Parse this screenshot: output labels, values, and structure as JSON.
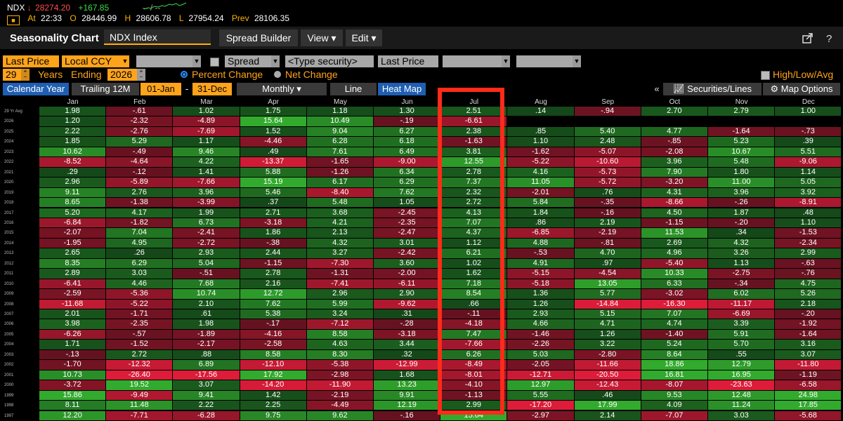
{
  "ticker": {
    "symbol": "NDX",
    "direction_glyph": "↓",
    "last": "28274.20",
    "change": "+167.85",
    "dash": "-- / --",
    "at_label": "At",
    "time": "22:33",
    "open_label": "O",
    "open": "28446.99",
    "high_label": "H",
    "high": "28606.78",
    "low_label": "L",
    "low": "27954.24",
    "prev_label": "Prev",
    "prev": "28106.35"
  },
  "header": {
    "title": "Seasonality Chart",
    "security": "NDX Index",
    "spread_builder": "Spread Builder",
    "view": "View ▾",
    "edit": "Edit ▾"
  },
  "options": {
    "price_field": "Last Price",
    "currency": "Local CCY",
    "spread": "Spread",
    "type_security": "<Type security>",
    "price_field2": "Last Price",
    "years": "29",
    "years_label": "Years",
    "ending_label": "Ending",
    "ending_year": "2026",
    "percent_change": "Percent Change",
    "net_change": "Net Change",
    "high_low_avg": "High/Low/Avg",
    "calendar_year": "Calendar Year",
    "trailing": "Trailing 12M",
    "start_date": "01-Jan",
    "range_dash": "-",
    "end_date": "31-Dec",
    "period": "Monthly ▾",
    "line": "Line",
    "heat_map": "Heat Map",
    "collapse": "«",
    "securities_lines": "Securities/Lines",
    "map_options": "Map Options"
  },
  "colors": {
    "accent": "#ffa31a",
    "highlight": "#ff2a1a",
    "active_tab": "#1f5fb3"
  },
  "heatmap": {
    "months": [
      "Jan",
      "Feb",
      "Mar",
      "Apr",
      "May",
      "Jun",
      "Jul",
      "Aug",
      "Sep",
      "Oct",
      "Nov",
      "Dec"
    ],
    "rows": [
      {
        "label": "29 Yr Avg",
        "values": [
          "1.98",
          "-.61",
          "1.02",
          "1.75",
          "1.18",
          "1.30",
          "2.51",
          ".14",
          "-.94",
          "2.70",
          "2.79",
          "1.00"
        ]
      },
      {
        "label": "2026",
        "values": [
          "1.20",
          "-2.32",
          "-4.89",
          "15.64",
          "10.49",
          "-.19",
          "-6.61",
          "",
          "",
          "",
          "",
          ""
        ]
      },
      {
        "label": "2025",
        "values": [
          "2.22",
          "-2.76",
          "-7.69",
          "1.52",
          "9.04",
          "6.27",
          "2.38",
          ".85",
          "5.40",
          "4.77",
          "-1.64",
          "-.73"
        ]
      },
      {
        "label": "2024",
        "values": [
          "1.85",
          "5.29",
          "1.17",
          "-4.46",
          "6.28",
          "6.18",
          "-1.63",
          "1.10",
          "2.48",
          "-.85",
          "5.23",
          ".39"
        ]
      },
      {
        "label": "2023",
        "values": [
          "10.62",
          "-.49",
          "9.46",
          ".49",
          "7.61",
          "6.49",
          "3.81",
          "-1.62",
          "-5.07",
          "-2.08",
          "10.67",
          "5.51"
        ]
      },
      {
        "label": "2022",
        "values": [
          "-8.52",
          "-4.64",
          "4.22",
          "-13.37",
          "-1.65",
          "-9.00",
          "12.55",
          "-5.22",
          "-10.60",
          "3.96",
          "5.48",
          "-9.06"
        ]
      },
      {
        "label": "2021",
        "values": [
          ".29",
          "-.12",
          "1.41",
          "5.88",
          "-1.26",
          "6.34",
          "2.78",
          "4.16",
          "-5.73",
          "7.90",
          "1.80",
          "1.14"
        ]
      },
      {
        "label": "2020",
        "values": [
          "2.96",
          "-5.89",
          "-7.66",
          "15.19",
          "6.17",
          "6.29",
          "7.37",
          "11.05",
          "-5.72",
          "-3.20",
          "11.00",
          "5.05"
        ]
      },
      {
        "label": "2019",
        "values": [
          "9.11",
          "2.76",
          "3.96",
          "5.46",
          "-8.40",
          "7.62",
          "2.32",
          "-2.01",
          ".76",
          "4.31",
          "3.96",
          "3.92"
        ]
      },
      {
        "label": "2018",
        "values": [
          "8.65",
          "-1.38",
          "-3.99",
          ".37",
          "5.48",
          "1.05",
          "2.72",
          "5.84",
          "-.35",
          "-8.66",
          "-.26",
          "-8.91"
        ]
      },
      {
        "label": "2017",
        "values": [
          "5.20",
          "4.17",
          "1.99",
          "2.71",
          "3.68",
          "-2.45",
          "4.13",
          "1.84",
          "-.16",
          "4.50",
          "1.87",
          ".48"
        ]
      },
      {
        "label": "2016",
        "values": [
          "-6.84",
          "-1.82",
          "6.73",
          "-3.18",
          "4.21",
          "-2.35",
          "7.07",
          ".86",
          "2.19",
          "-1.15",
          "-.20",
          "1.10"
        ]
      },
      {
        "label": "2015",
        "values": [
          "-2.07",
          "7.04",
          "-2.41",
          "1.86",
          "2.13",
          "-2.47",
          "4.37",
          "-6.85",
          "-2.19",
          "11.53",
          ".34",
          "-1.53"
        ]
      },
      {
        "label": "2014",
        "values": [
          "-1.95",
          "4.95",
          "-2.72",
          "-.38",
          "4.32",
          "3.01",
          "1.12",
          "4.88",
          "-.81",
          "2.69",
          "4.32",
          "-2.34"
        ]
      },
      {
        "label": "2013",
        "values": [
          "2.65",
          ".26",
          "2.93",
          "2.44",
          "3.27",
          "-2.42",
          "6.21",
          "-.53",
          "4.70",
          "4.96",
          "3.26",
          "2.99"
        ]
      },
      {
        "label": "2012",
        "values": [
          "8.35",
          "6.29",
          "5.04",
          "-1.15",
          "-7.30",
          "3.60",
          "1.02",
          "4.91",
          ".97",
          "-5.40",
          "1.13",
          "-.63"
        ]
      },
      {
        "label": "2011",
        "values": [
          "2.89",
          "3.03",
          "-.51",
          "2.78",
          "-1.31",
          "-2.00",
          "1.62",
          "-5.15",
          "-4.54",
          "10.33",
          "-2.75",
          "-.76"
        ]
      },
      {
        "label": "2010",
        "values": [
          "-6.41",
          "4.46",
          "7.68",
          "2.16",
          "-7.41",
          "-6.11",
          "7.18",
          "-5.18",
          "13.05",
          "6.33",
          "-.34",
          "4.75"
        ]
      },
      {
        "label": "2009",
        "values": [
          "-2.59",
          "-5.36",
          "10.74",
          "12.72",
          "2.96",
          "2.90",
          "8.54",
          "1.36",
          "5.77",
          "-3.02",
          "6.02",
          "5.26"
        ]
      },
      {
        "label": "2008",
        "values": [
          "-11.68",
          "-5.22",
          "2.10",
          "7.62",
          "5.99",
          "-9.62",
          ".66",
          "1.26",
          "-14.84",
          "-16.30",
          "-11.17",
          "2.18"
        ]
      },
      {
        "label": "2007",
        "values": [
          "2.01",
          "-1.71",
          ".61",
          "5.38",
          "3.24",
          ".31",
          "-.11",
          "2.93",
          "5.15",
          "7.07",
          "-6.69",
          "-.20"
        ]
      },
      {
        "label": "2006",
        "values": [
          "3.98",
          "-2.35",
          "1.98",
          "-.17",
          "-7.12",
          "-.28",
          "-4.18",
          "4.66",
          "4.71",
          "4.74",
          "3.39",
          "-1.92"
        ]
      },
      {
        "label": "2005",
        "values": [
          "-6.26",
          "-.57",
          "-1.89",
          "-4.16",
          "8.58",
          "-3.18",
          "7.47",
          "-1.46",
          "1.26",
          "-1.40",
          "5.91",
          "-1.64"
        ]
      },
      {
        "label": "2004",
        "values": [
          "1.71",
          "-1.52",
          "-2.17",
          "-2.58",
          "4.63",
          "3.44",
          "-7.66",
          "-2.26",
          "3.22",
          "5.24",
          "5.70",
          "3.16"
        ]
      },
      {
        "label": "2003",
        "values": [
          "-.13",
          "2.72",
          ".88",
          "8.58",
          "8.30",
          ".32",
          "6.26",
          "5.03",
          "-2.80",
          "8.64",
          ".55",
          "3.07"
        ]
      },
      {
        "label": "2002",
        "values": [
          "-1.70",
          "-12.32",
          "6.89",
          "-12.10",
          "-5.38",
          "-12.99",
          "-8.49",
          "-2.05",
          "-11.66",
          "18.86",
          "12.79",
          "-11.80"
        ]
      },
      {
        "label": "2001",
        "values": [
          "10.73",
          "-26.40",
          "-17.56",
          "17.92",
          "-2.98",
          "1.68",
          "-8.01",
          "-12.71",
          "-20.50",
          "16.81",
          "16.95",
          "-1.19"
        ]
      },
      {
        "label": "2000",
        "values": [
          "-3.72",
          "19.52",
          "3.07",
          "-14.20",
          "-11.90",
          "13.23",
          "-4.10",
          "12.97",
          "-12.43",
          "-8.07",
          "-23.63",
          "-6.58"
        ]
      },
      {
        "label": "1999",
        "values": [
          "15.86",
          "-9.49",
          "9.41",
          "1.42",
          "-2.19",
          "9.91",
          "-1.13",
          "5.55",
          ".46",
          "9.53",
          "12.48",
          "24.98"
        ]
      },
      {
        "label": "1998",
        "values": [
          "8.11",
          "11.48",
          "2.22",
          "2.25",
          "-4.49",
          "12.19",
          "2.99",
          "-17.20",
          "17.99",
          "4.09",
          "11.24",
          "17.85"
        ]
      },
      {
        "label": "1997",
        "values": [
          "12.20",
          "-7.71",
          "-6.28",
          "9.75",
          "9.62",
          "-.16",
          "15.64",
          "-2.97",
          "2.14",
          "-7.07",
          "3.03",
          "-5.68"
        ]
      }
    ]
  }
}
